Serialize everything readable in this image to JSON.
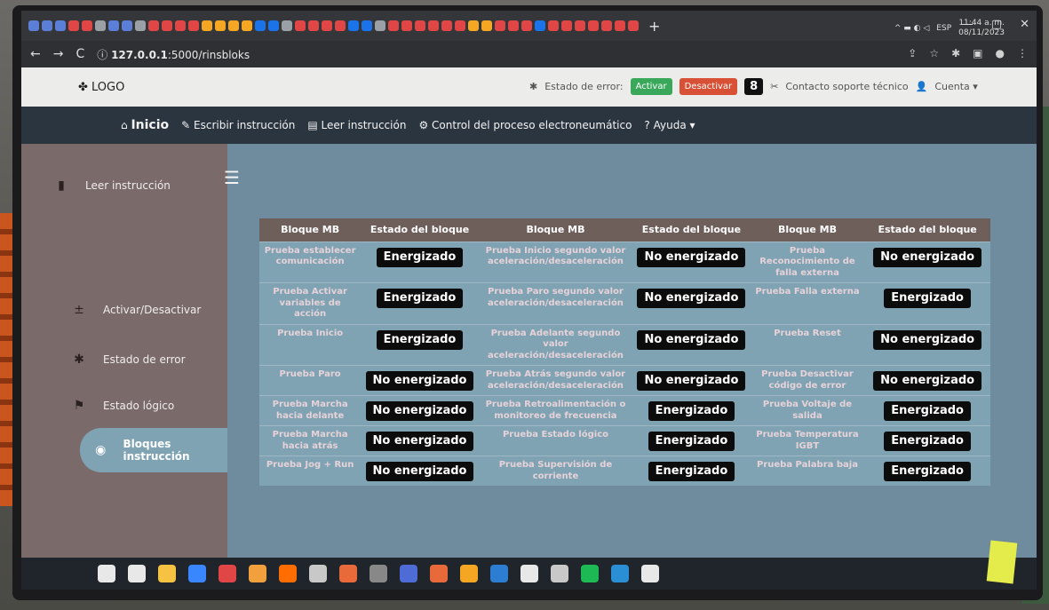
{
  "browser": {
    "url_host": "127.0.0.1",
    "url_path": ":5000/rinsbloks",
    "new_tab": "+",
    "tab_colors": [
      "#5b7fd6",
      "#5b7fd6",
      "#5b7fd6",
      "#e04646",
      "#e04646",
      "#9aa0a6",
      "#5b7fd6",
      "#5b7fd6",
      "#9aa0a6",
      "#e04646",
      "#e04646",
      "#e04646",
      "#e04646",
      "#f5a623",
      "#f5a623",
      "#f5a623",
      "#f5a623",
      "#1a73e8",
      "#1a73e8",
      "#9aa0a6",
      "#e04646",
      "#e04646",
      "#e04646",
      "#e04646",
      "#1a73e8",
      "#1a73e8",
      "#9aa0a6",
      "#e04646",
      "#e04646",
      "#e04646",
      "#e04646",
      "#e04646",
      "#e04646",
      "#f5a623",
      "#f5a623",
      "#e04646",
      "#e04646",
      "#e04646",
      "#1a73e8",
      "#e04646",
      "#e04646",
      "#e04646",
      "#e04646",
      "#e04646",
      "#e04646",
      "#e04646"
    ]
  },
  "header": {
    "logo": "LOGO",
    "error_state_label": "Estado de error:",
    "activate": "Activar",
    "deactivate": "Desactivar",
    "error_count": "8",
    "support": "Contacto soporte técnico",
    "account": "Cuenta ▾"
  },
  "nav": {
    "home": "Inicio",
    "write": "Escribir instrucción",
    "read": "Leer instrucción",
    "control": "Control del proceso electroneumático",
    "help": "Ayuda ▾"
  },
  "sidebar": {
    "items": [
      {
        "label": "Leer instrucción",
        "icon": "document-icon"
      },
      {
        "label": "Activar/Desactivar",
        "icon": "plus-minus-icon"
      },
      {
        "label": "Estado de error",
        "icon": "bug-icon"
      },
      {
        "label": "Estado lógico",
        "icon": "flag-icon"
      },
      {
        "label": "Bloques instrucción",
        "icon": "block-icon"
      }
    ]
  },
  "table": {
    "headers": [
      "Bloque MB",
      "Estado del bloque",
      "Bloque MB",
      "Estado del bloque",
      "Bloque MB",
      "Estado del bloque"
    ],
    "rows": [
      [
        "Prueba establecer comunicación",
        "Energizado",
        "Prueba Inicio segundo valor aceleración/desaceleración",
        "No energizado",
        "Prueba Reconocimiento de falla externa",
        "No energizado"
      ],
      [
        "Prueba Activar variables de acción",
        "Energizado",
        "Prueba Paro segundo valor aceleración/desaceleración",
        "No energizado",
        "Prueba Falla externa",
        "Energizado"
      ],
      [
        "Prueba Inicio",
        "Energizado",
        "Prueba Adelante segundo valor aceleración/desaceleración",
        "No energizado",
        "Prueba Reset",
        "No energizado"
      ],
      [
        "Prueba Paro",
        "No energizado",
        "Prueba Atrás segundo valor aceleración/desaceleración",
        "No energizado",
        "Prueba Desactivar código de error",
        "No energizado"
      ],
      [
        "Prueba Marcha hacia delante",
        "No energizado",
        "Prueba Retroalimentación o monitoreo de frecuencia",
        "Energizado",
        "Prueba Voltaje de salida",
        "Energizado"
      ],
      [
        "Prueba Marcha hacia atrás",
        "No energizado",
        "Prueba Estado lógico",
        "Energizado",
        "Prueba Temperatura IGBT",
        "Energizado"
      ],
      [
        "Prueba Jog + Run",
        "No energizado",
        "Prueba Supervisión de corriente",
        "Energizado",
        "Prueba Palabra baja",
        "Energizado"
      ]
    ]
  },
  "taskbar": {
    "lang": "ESP",
    "time": "11:44 a. m.",
    "date": "08/11/2023",
    "icon_colors": [
      "#e8e8e8",
      "#e8e8e8",
      "#f5c242",
      "#3a86ff",
      "#e04646",
      "#f2a03d",
      "#ff6d00",
      "#c8c8c8",
      "#e86a3a",
      "#888",
      "#4f6bd6",
      "#e86a3a",
      "#f5a623",
      "#2d7dd2",
      "#e8e8e8",
      "#c8c8c8",
      "#1db954",
      "#2b8fd6",
      "#e8e8e8"
    ]
  }
}
